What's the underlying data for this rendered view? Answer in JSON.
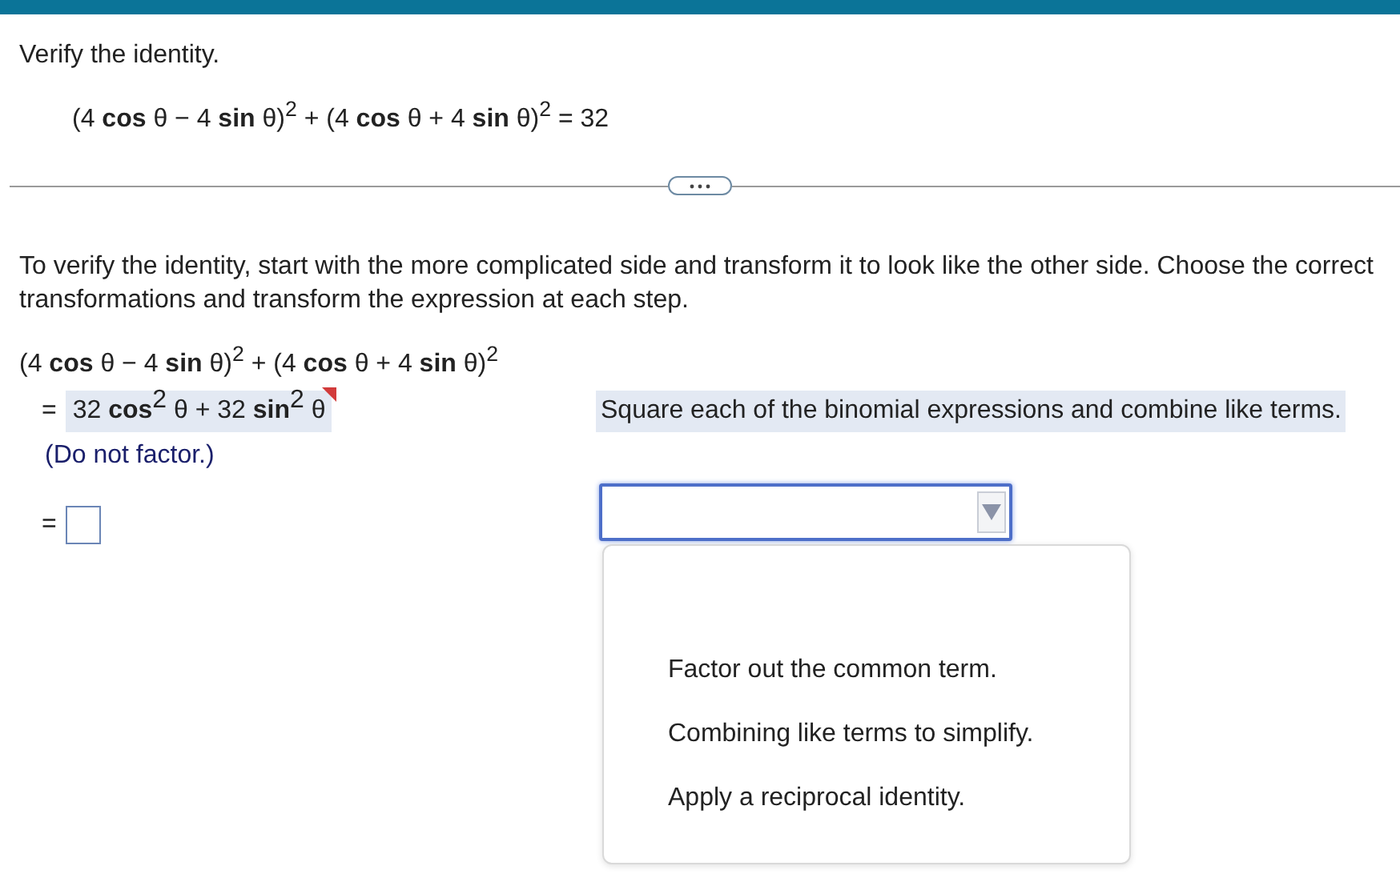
{
  "prompt": "Verify the identity.",
  "identity": "(4 **cos** θ − 4 **sin** θ)$^{2}$ + (4 **cos** θ + 4 **sin** θ)$^{2}$ = 32",
  "instructions": "To verify the identity, start with the more complicated side and transform it to look like the other side. Choose the correct transformations and transform the expression at each step.",
  "work": {
    "expression": "(4 **cos** θ − 4 **sin** θ)$^{2}$ + (4 **cos** θ + 4 **sin** θ)$^{2}$",
    "steps": [
      {
        "kind": "completed",
        "equals": "=",
        "result": "32 **cos**$^{2}$ θ + 32 **sin**$^{2}$ θ",
        "flagged": true,
        "note": "(Do not factor.)",
        "reason": "Square each of the binomial expressions and combine like terms."
      },
      {
        "kind": "pending",
        "equals": "=",
        "expanded": true,
        "options": [
          {
            "label": "Factor out the common term.",
            "selected": false
          },
          {
            "label": "Combining like terms to simplify.",
            "selected": false
          },
          {
            "label": "Apply a reciprocal identity.",
            "selected": false
          }
        ]
      }
    ]
  }
}
